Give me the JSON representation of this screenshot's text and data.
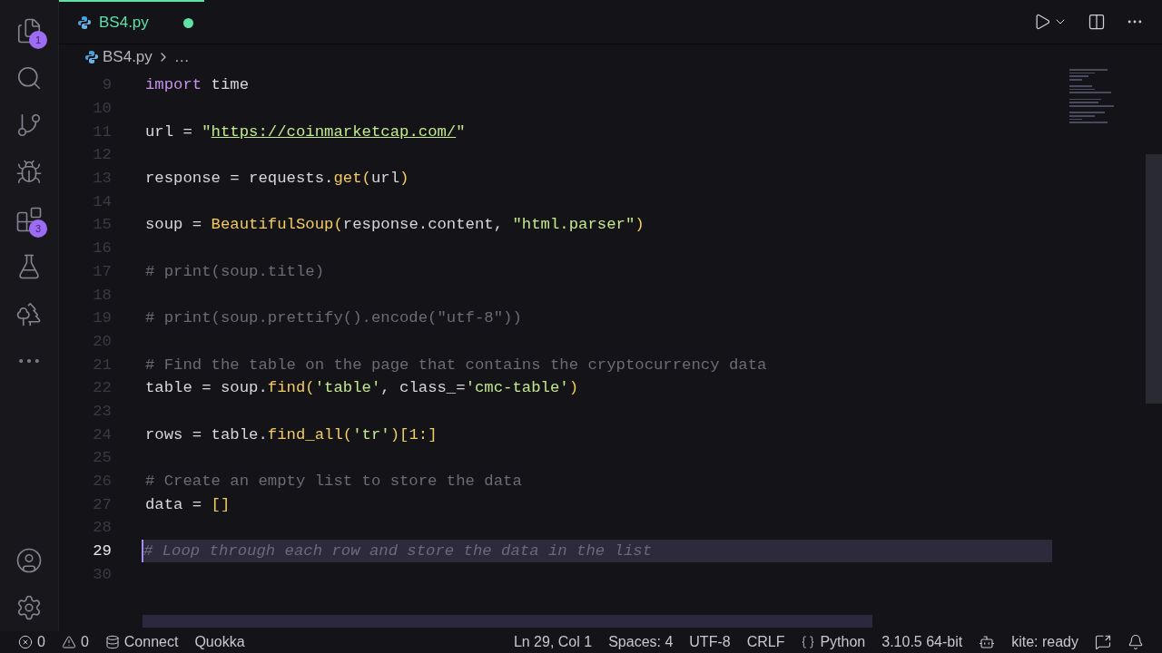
{
  "activity_bar": {
    "items": [
      {
        "kind": "files",
        "badge": "1",
        "selected": false
      },
      {
        "kind": "search",
        "selected": false
      },
      {
        "kind": "source-control",
        "selected": false
      },
      {
        "kind": "run-debug",
        "selected": false
      },
      {
        "kind": "extensions",
        "badge": "3",
        "selected": false
      },
      {
        "kind": "testing",
        "selected": false
      },
      {
        "kind": "tree",
        "selected": false
      },
      {
        "kind": "more",
        "selected": false
      }
    ],
    "bottom_items": [
      {
        "kind": "account"
      },
      {
        "kind": "settings"
      }
    ]
  },
  "tabs": [
    {
      "label": "BS4.py",
      "modified": true,
      "selected": true
    }
  ],
  "breadcrumb": [
    "BS4.py",
    "…"
  ],
  "editor": {
    "lines": [
      {
        "number": "9",
        "tokens": [
          {
            "kind": "keyword",
            "text": "import"
          },
          {
            "kind": "plain",
            "text": " time"
          }
        ]
      },
      {
        "number": "10"
      },
      {
        "number": "11",
        "tokens": [
          {
            "kind": "plain",
            "text": "url = "
          },
          {
            "kind": "string",
            "text": "\""
          },
          {
            "kind": "link",
            "text": "https://coinmarketcap.com/"
          },
          {
            "kind": "string",
            "text": "\""
          }
        ]
      },
      {
        "number": "12"
      },
      {
        "number": "13",
        "tokens": [
          {
            "kind": "plain",
            "text": "response = requests."
          },
          {
            "kind": "function",
            "text": "get"
          },
          {
            "kind": "paren",
            "text": "("
          },
          {
            "kind": "plain",
            "text": "url"
          },
          {
            "kind": "paren",
            "text": ")"
          }
        ]
      },
      {
        "number": "14"
      },
      {
        "number": "15",
        "tokens": [
          {
            "kind": "plain",
            "text": "soup = "
          },
          {
            "kind": "function",
            "text": "BeautifulSoup"
          },
          {
            "kind": "paren",
            "text": "("
          },
          {
            "kind": "plain",
            "text": "response.content, "
          },
          {
            "kind": "string",
            "text": "\"html.parser\""
          },
          {
            "kind": "paren",
            "text": ")"
          }
        ]
      },
      {
        "number": "16"
      },
      {
        "number": "17",
        "tokens": [
          {
            "kind": "comment",
            "text": "# print(soup.title)"
          }
        ]
      },
      {
        "number": "18"
      },
      {
        "number": "19",
        "tokens": [
          {
            "kind": "comment",
            "text": "# print(soup.prettify().encode(\"utf-8\"))"
          }
        ]
      },
      {
        "number": "20"
      },
      {
        "number": "21",
        "tokens": [
          {
            "kind": "comment",
            "text": "# Find the table on the page that contains the cryptocurrency data"
          }
        ]
      },
      {
        "number": "22",
        "tokens": [
          {
            "kind": "plain",
            "text": "table = soup."
          },
          {
            "kind": "function",
            "text": "find"
          },
          {
            "kind": "paren",
            "text": "("
          },
          {
            "kind": "string",
            "text": "'table'"
          },
          {
            "kind": "plain",
            "text": ", class_="
          },
          {
            "kind": "string",
            "text": "'cmc-table'"
          },
          {
            "kind": "paren",
            "text": ")"
          }
        ]
      },
      {
        "number": "23"
      },
      {
        "number": "24",
        "tokens": [
          {
            "kind": "plain",
            "text": "rows = table."
          },
          {
            "kind": "function",
            "text": "find_all"
          },
          {
            "kind": "paren",
            "text": "("
          },
          {
            "kind": "string",
            "text": "'tr'"
          },
          {
            "kind": "paren",
            "text": ")[1:]"
          }
        ]
      },
      {
        "number": "25"
      },
      {
        "number": "26",
        "tokens": [
          {
            "kind": "comment",
            "text": "# Create an empty list to store the data"
          }
        ]
      },
      {
        "number": "27",
        "tokens": [
          {
            "kind": "plain",
            "text": "data = "
          },
          {
            "kind": "paren",
            "text": "[]"
          }
        ]
      },
      {
        "number": "28"
      },
      {
        "number": "29",
        "current": true,
        "tokens": [
          {
            "kind": "italic-comment",
            "text": "# Loop through each row and store the data in the list"
          }
        ]
      },
      {
        "number": "30"
      }
    ]
  },
  "status_bar": {
    "left": [
      {
        "kind": "errors",
        "text": "0"
      },
      {
        "kind": "warnings",
        "text": "0"
      },
      {
        "kind": "database",
        "text": "Connect"
      },
      {
        "kind": "plain",
        "text": "Quokka"
      }
    ],
    "right": [
      {
        "kind": "plain",
        "text": "Ln 29, Col 1"
      },
      {
        "kind": "plain",
        "text": "Spaces: 4"
      },
      {
        "kind": "plain",
        "text": "UTF-8"
      },
      {
        "kind": "plain",
        "text": "CRLF"
      },
      {
        "kind": "language",
        "text": "Python"
      },
      {
        "kind": "plain",
        "text": "3.10.5 64-bit"
      },
      {
        "kind": "copilot"
      },
      {
        "kind": "plain",
        "text": "kite: ready"
      },
      {
        "kind": "feedback"
      },
      {
        "kind": "bell"
      }
    ]
  }
}
